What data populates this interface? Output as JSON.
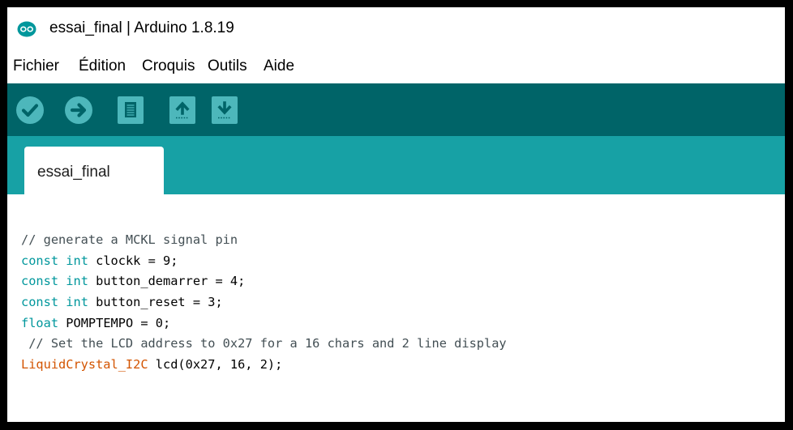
{
  "window": {
    "title": "essai_final | Arduino 1.8.19",
    "logo_icon": "arduino-logo-icon",
    "logo_color": "#00979c"
  },
  "menubar": {
    "items": [
      "Fichier",
      "Édition",
      "Croquis",
      "Outils",
      "Aide"
    ]
  },
  "toolbar": {
    "background": "#006468",
    "buttons": [
      {
        "name": "verify",
        "icon": "checkmark-icon"
      },
      {
        "name": "upload",
        "icon": "arrow-right-icon"
      },
      {
        "name": "new",
        "icon": "new-file-icon"
      },
      {
        "name": "open",
        "icon": "arrow-up-icon"
      },
      {
        "name": "save",
        "icon": "arrow-down-icon"
      }
    ]
  },
  "tabs": {
    "background": "#17a1a5",
    "items": [
      {
        "label": "essai_final",
        "active": true
      }
    ]
  },
  "editor": {
    "lines": [
      [
        {
          "t": "// generate a MCKL signal pin",
          "c": "comment"
        }
      ],
      [
        {
          "t": "const",
          "c": "keyword"
        },
        {
          "t": " ",
          "c": "plain"
        },
        {
          "t": "int",
          "c": "keyword"
        },
        {
          "t": " clockk = 9;",
          "c": "plain"
        }
      ],
      [
        {
          "t": "const",
          "c": "keyword"
        },
        {
          "t": " ",
          "c": "plain"
        },
        {
          "t": "int",
          "c": "keyword"
        },
        {
          "t": " button_demarrer = 4;",
          "c": "plain"
        }
      ],
      [
        {
          "t": "const",
          "c": "keyword"
        },
        {
          "t": " ",
          "c": "plain"
        },
        {
          "t": "int",
          "c": "keyword"
        },
        {
          "t": " button_reset = 3;",
          "c": "plain"
        }
      ],
      [
        {
          "t": "float",
          "c": "keyword"
        },
        {
          "t": " POMPTEMPO = 0;",
          "c": "plain"
        }
      ],
      [
        {
          "t": " // Set the LCD address to 0x27 for a 16 chars and 2 line display",
          "c": "comment"
        }
      ],
      [
        {
          "t": "LiquidCrystal_I2C",
          "c": "type"
        },
        {
          "t": " lcd(0x27, 16, 2);",
          "c": "plain"
        }
      ]
    ]
  }
}
